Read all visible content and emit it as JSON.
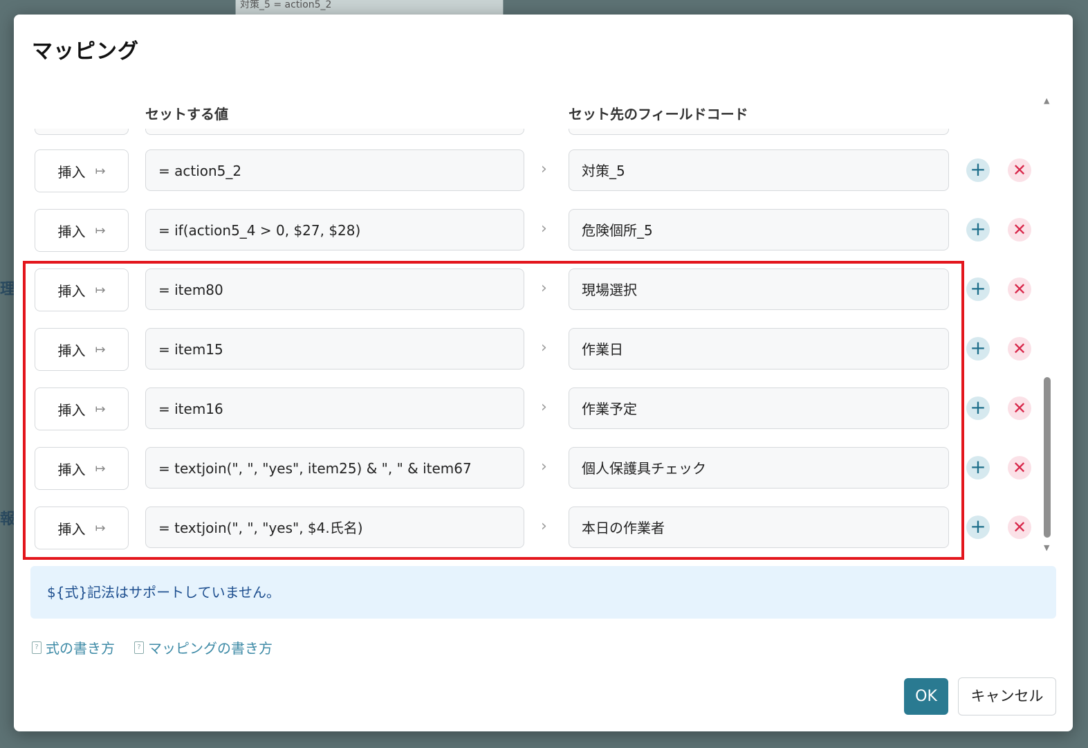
{
  "background": {
    "top_card_text": "対策_5 = action5_2",
    "side_chars": [
      "理",
      "報"
    ]
  },
  "dialog": {
    "title": "マッピング",
    "columns": {
      "value": "セットする値",
      "target": "セット先のフィールドコード"
    },
    "rows": [
      {
        "mode": "挿入",
        "value": "= action5_2",
        "target": "対策_5"
      },
      {
        "mode": "挿入",
        "value": "= if(action5_4 > 0, $27, $28)",
        "target": "危険個所_5"
      },
      {
        "mode": "挿入",
        "value": "= item80",
        "target": "現場選択"
      },
      {
        "mode": "挿入",
        "value": "= item15",
        "target": "作業日"
      },
      {
        "mode": "挿入",
        "value": "= item16",
        "target": "作業予定"
      },
      {
        "mode": "挿入",
        "value": "= textjoin(\", \", \"yes\", item25) & \", \" & item67",
        "target": "個人保護具チェック"
      },
      {
        "mode": "挿入",
        "value": "= textjoin(\", \", \"yes\", $4.氏名)",
        "target": "本日の作業者"
      }
    ],
    "notice": "${式}記法はサポートしていません。",
    "help_links": [
      "式の書き方",
      "マッピングの書き方"
    ],
    "buttons": {
      "ok": "OK",
      "cancel": "キャンセル"
    }
  },
  "colors": {
    "accent": "#2a7a91",
    "highlight": "#e3161d",
    "delete": "#d8274a",
    "notice_bg": "#e6f3fd"
  },
  "icons": {
    "insert": "arrow-right-from-bar-icon",
    "chevron": "chevron-right-icon",
    "add": "plus-icon",
    "delete": "close-icon",
    "doc": "document-help-icon"
  }
}
